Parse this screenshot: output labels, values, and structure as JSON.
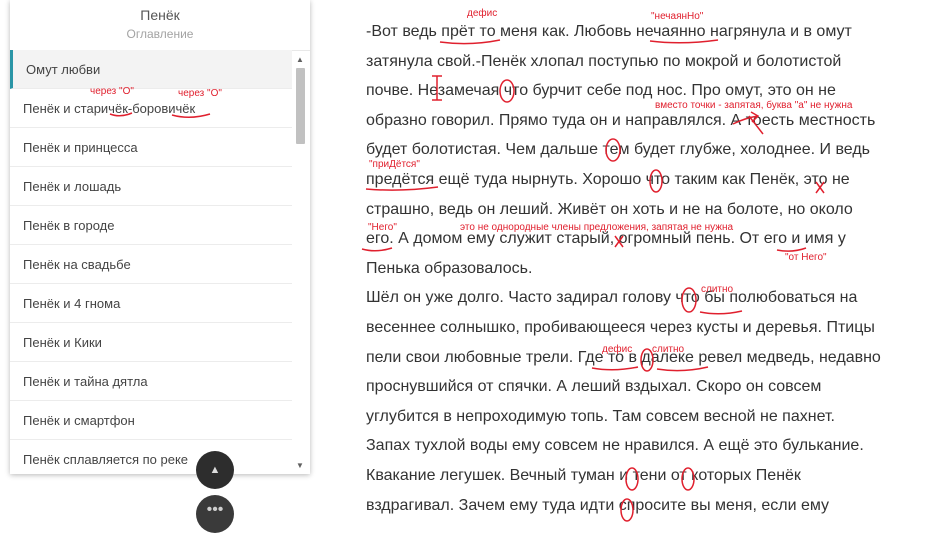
{
  "toc": {
    "title": "Пенёк",
    "subtitle": "Оглавление",
    "items": [
      {
        "label": "Омут любви"
      },
      {
        "label": "Пенёк и старичёк-боровичёк"
      },
      {
        "label": "Пенёк и принцесса"
      },
      {
        "label": "Пенёк и лошадь"
      },
      {
        "label": "Пенёк в городе"
      },
      {
        "label": "Пенёк на свадьбе"
      },
      {
        "label": "Пенёк и 4 гнома"
      },
      {
        "label": "Пенёк и Кики"
      },
      {
        "label": "Пенёк и тайна дятла"
      },
      {
        "label": "Пенёк и смартфон"
      },
      {
        "label": "Пенёк сплавляется по реке"
      }
    ],
    "annotations": {
      "a1": "через \"О\"",
      "a2": "через \"О\""
    }
  },
  "buttons": {
    "more_label": "•••",
    "top_label": "▲"
  },
  "text": {
    "lines": [
      "-Вот ведь прёт то меня как. Любовь нечаянно нагрянула и в омут",
      "затянула свой.-Пенёк хлопал поступью по мокрой и болотистой",
      "почве. Незамечая что бурчит себе под нос. Про омут, это он не",
      "образно говорил. Прямо туда он и направлялся. А тоесть местность",
      "будет болотистая. Чем дальше тем будет глубже, холоднее. И ведь",
      "предётся ещё туда нырнуть. Хорошо что таким как Пенёк, это не",
      "страшно, ведь он леший. Живёт он хоть и не на болоте, но около",
      "его. А домом ему служит старый, огромный пень. От его и имя у",
      "Пенька образовалось.",
      "Шёл он уже долго. Часто задирал голову что бы полюбоваться на",
      "весеннее солнышко, пробивающееся через кусты и деревья. Птицы",
      "пели свои любовные трели. Где то в далеке ревел медведь, недавно",
      "проснувшийся от спячки. А леший вздыхал. Скоро он совсем",
      "углубится в непроходимую топь. Там совсем весной не пахнет.",
      "Запах тухлой воды ему совсем не нравился. А ещё это булькание.",
      "Квакание легушек. Вечный туман и тени от которых Пенёк",
      "вздрагивал. Зачем ему туда идти спросите вы меня, если ему"
    ],
    "annotations": {
      "defis1": "дефис",
      "nechayanno": "\"нечаянНо\"",
      "vmesto": "вместо точки - запятая, буква \"а\" не нужна",
      "pridetsya": "\"приДётся\"",
      "nego": "\"Него\"",
      "odnorodnye": "это не однородные члены предложения, запятая не нужна",
      "ot_nego": "\"от Него\"",
      "slitno1": "слитно",
      "defis2": "дефис",
      "slitno2": "слитно"
    }
  }
}
